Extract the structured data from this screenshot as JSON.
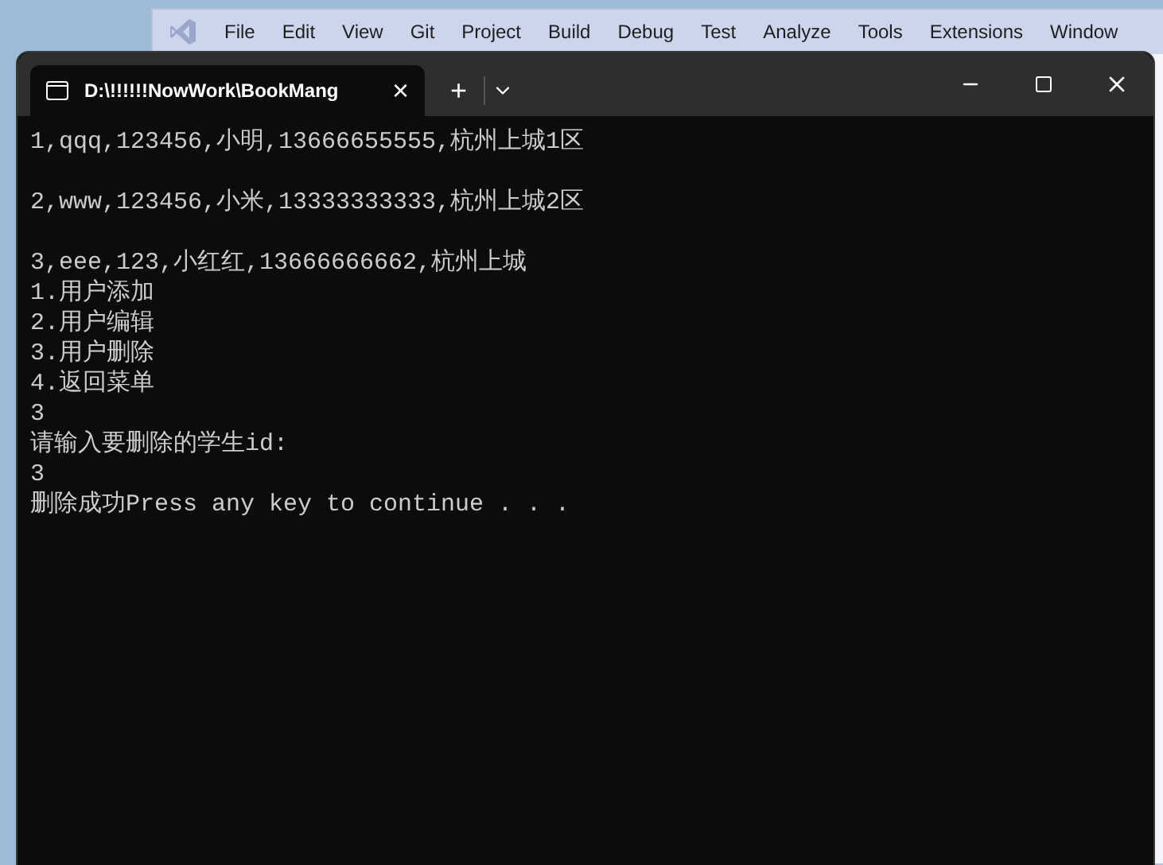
{
  "ide_window": {
    "menu": [
      "File",
      "Edit",
      "View",
      "Git",
      "Project",
      "Build",
      "Debug",
      "Test",
      "Analyze",
      "Tools",
      "Extensions",
      "Window"
    ]
  },
  "terminal": {
    "tab": {
      "title": "D:\\!!!!!!NowWork\\BookMang",
      "close": "×"
    },
    "new_tab": "+",
    "output_blocks": [
      [
        "1,qqq,123456,小明,13666655555,杭州上城1区"
      ],
      [
        "2,www,123456,小米,13333333333,杭州上城2区"
      ],
      [
        "3,eee,123,小红红,13666666662,杭州上城",
        "1.用户添加",
        "2.用户编辑",
        "3.用户删除",
        "4.返回菜单",
        "3",
        "请输入要删除的学生id:",
        "3",
        "删除成功Press any key to continue . . ."
      ]
    ]
  }
}
